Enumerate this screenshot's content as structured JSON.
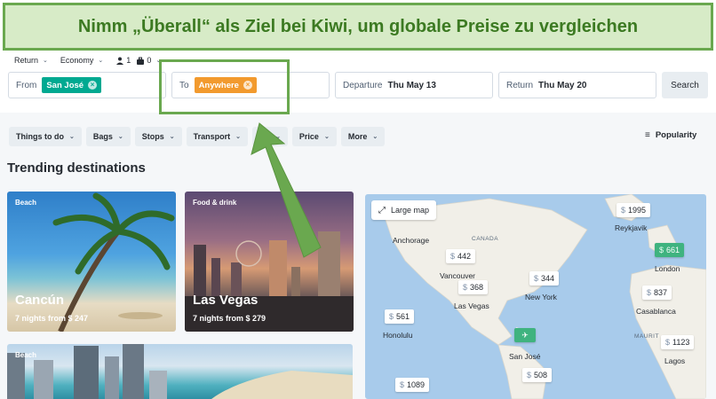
{
  "banner": {
    "text": "Nimm „Überall“ als Ziel bei Kiwi, um globale Preise zu vergleichen"
  },
  "options": {
    "trip_type": "Return",
    "cabin": "Economy",
    "adults": "1",
    "bags": "0"
  },
  "search": {
    "from_label": "From",
    "from_value": "San José",
    "to_label": "To",
    "to_value": "Anywhere",
    "departure_label": "Departure",
    "departure_value": "Thu May 13",
    "return_label": "Return",
    "return_value": "Thu May 20",
    "button": "Search"
  },
  "filters": [
    "Things to do",
    "Bags",
    "Stops",
    "Transport",
    "Du",
    "Price",
    "More"
  ],
  "sort": {
    "label": "Popularity"
  },
  "section_title": "Trending destinations",
  "cards": [
    {
      "tag": "Beach",
      "city": "Cancún",
      "price": "7 nights from $ 247"
    },
    {
      "tag": "Food & drink",
      "city": "Las Vegas",
      "price": "7 nights from $ 279"
    },
    {
      "tag": "Beach"
    }
  ],
  "map": {
    "large_map": "Large map",
    "currency": "$",
    "pins": [
      "1995",
      "442",
      "344",
      "368",
      "561",
      "661",
      "837",
      "1123",
      "508",
      "1089"
    ],
    "cities": [
      "Anchorage",
      "Reykjavik",
      "Vancouver",
      "New York",
      "Las Vegas",
      "Honolulu",
      "London",
      "Casablanca",
      "San José",
      "Lagos"
    ],
    "regions": [
      "CANADA",
      "MAURIT"
    ]
  },
  "colors": {
    "from_chip": "#00a991",
    "to_chip": "#f29a2e",
    "annotation": "#6aa84f"
  }
}
